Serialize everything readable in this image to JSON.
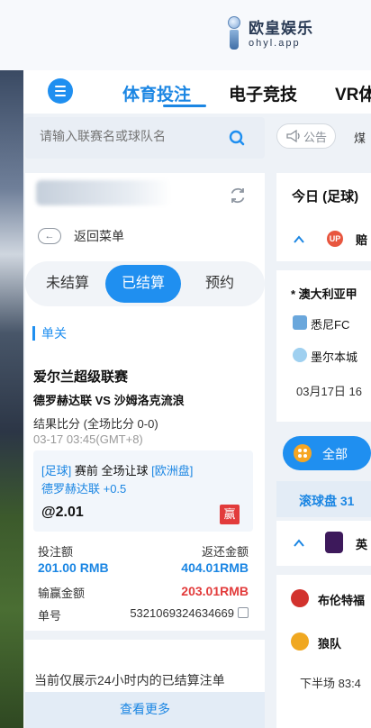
{
  "brand": {
    "name_cn": "欧皇娱乐",
    "name_en": "ohyl.app"
  },
  "nav": {
    "tabs": [
      {
        "label": "体育投注",
        "active": true
      },
      {
        "label": "电子竞技",
        "active": false
      },
      {
        "label": "VR体",
        "active": false
      }
    ]
  },
  "search": {
    "placeholder": "请输入联赛名或球队名"
  },
  "notice": {
    "label": "公告",
    "more": "煤"
  },
  "panel": {
    "back_label": "返回菜单",
    "segments": [
      {
        "label": "未结算",
        "active": false
      },
      {
        "label": "已结算",
        "active": true
      },
      {
        "label": "预约",
        "active": false
      }
    ],
    "section_title": "单关",
    "bet": {
      "league": "爱尔兰超级联赛",
      "match": "德罗赫达联 VS 沙姆洛克流浪",
      "result": "结果比分 (全场比分 0-0)",
      "time": "03-17 03:45(GMT+8)",
      "pick_tag": "[足球]",
      "pick_desc": "赛前 全场让球",
      "pick_market": "[欧洲盘]",
      "pick_selection": "德罗赫达联 +0.5",
      "odds": "@2.01",
      "outcome_badge": "赢",
      "stake_label": "投注额",
      "stake_value": "201.00 RMB",
      "return_label": "返还金额",
      "return_value": "404.01RMB",
      "winloss_label": "输赢金额",
      "winloss_value": "203.01RMB",
      "order_label": "单号",
      "order_value": "5321069324634669"
    },
    "footer_note": "当前仅展示24小时内的已结算注单",
    "see_more": "查看更多"
  },
  "right": {
    "today": "今日 (足球)",
    "group_label": "赔",
    "group_badge": "UP",
    "league": "* 澳大利亚甲",
    "home": "悉尼FC",
    "away": "墨尔本城",
    "date": "03月17日 16",
    "all_button": "全部",
    "live_label": "滚球盘 31",
    "epl_label": "英",
    "team_a": "布伦特福",
    "team_b": "狼队",
    "half": "下半场 83:4"
  },
  "colors": {
    "accent": "#1f8ff0",
    "win": "#e23b3b"
  }
}
